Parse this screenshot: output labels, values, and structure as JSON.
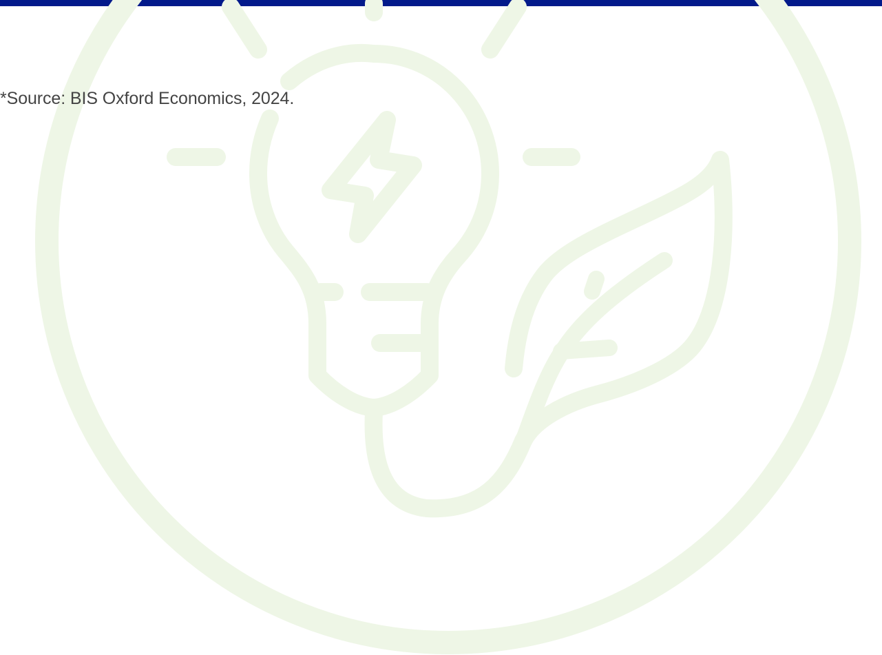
{
  "colors": {
    "top_bar": "#031a8b",
    "illustration": "#eef6e6",
    "text": "#444444",
    "background": "#ffffff"
  },
  "illustration": {
    "icon": "lightbulb-leaf-icon"
  },
  "footnote": {
    "source": "*Source: BIS Oxford Economics, 2024."
  }
}
